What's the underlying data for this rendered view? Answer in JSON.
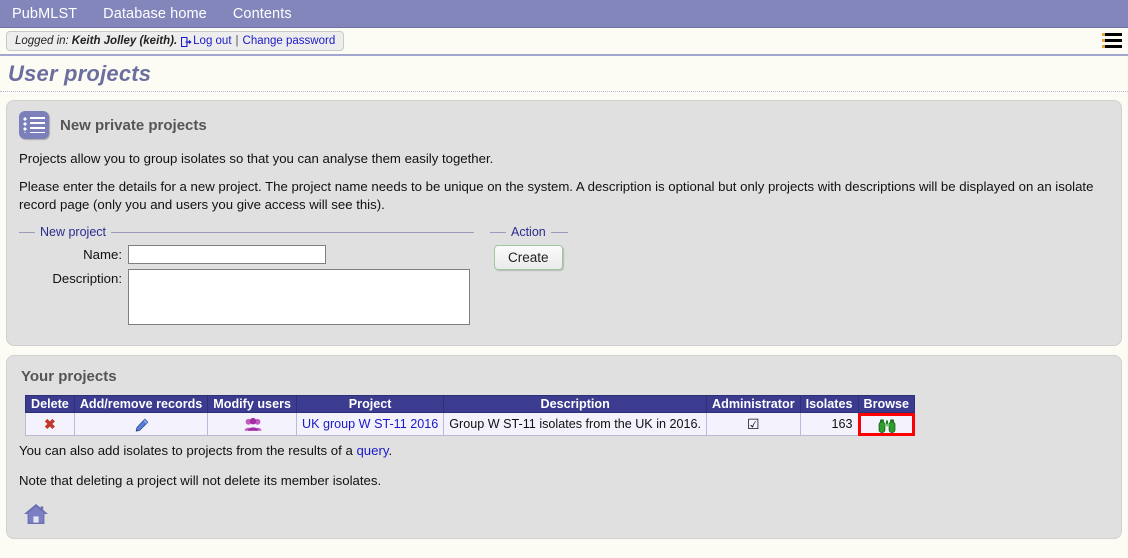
{
  "topnav": {
    "items": [
      {
        "label": "PubMLST",
        "name": "nav-pubmlst"
      },
      {
        "label": "Database home",
        "name": "nav-database-home"
      },
      {
        "label": "Contents",
        "name": "nav-contents"
      }
    ]
  },
  "loginbar": {
    "prefix": "Logged in:",
    "user": "Keith Jolley (keith).",
    "logout_label": "Log out",
    "separator": "|",
    "change_password_label": "Change password",
    "menu_icon": "hamburger-icon"
  },
  "page": {
    "title": "User projects"
  },
  "new_projects_panel": {
    "icon": "list-icon",
    "heading": "New private projects",
    "intro": "Projects allow you to group isolates so that you can analyse them easily together.",
    "description": "Please enter the details for a new project. The project name needs to be unique on the system. A description is optional but only projects with descriptions will be displayed on an isolate record page (only you and users you give access will see this).",
    "fieldset_new_project": {
      "legend": "New project",
      "name_label": "Name:",
      "name_value": "",
      "description_label": "Description:",
      "description_value": ""
    },
    "fieldset_action": {
      "legend": "Action",
      "create_label": "Create"
    }
  },
  "your_projects_panel": {
    "heading": "Your projects",
    "table": {
      "columns": [
        "Delete",
        "Add/remove records",
        "Modify users",
        "Project",
        "Description",
        "Administrator",
        "Isolates",
        "Browse"
      ],
      "rows": [
        {
          "delete_icon": "delete-cross-icon",
          "add_remove_icon": "pencil-icon",
          "modify_users_icon": "users-icon",
          "project": "UK group W ST-11 2016",
          "description": "Group W ST-11 isolates from the UK in 2016.",
          "administrator": "☑",
          "isolates": "163",
          "browse_icon": "binoculars-icon",
          "browse_highlight_color": "#ff0000"
        }
      ]
    },
    "note_query_prefix": "You can also add isolates to projects from the results of a ",
    "note_query_link": "query",
    "note_query_suffix": ".",
    "note_delete": "Note that deleting a project will not delete its member isolates.",
    "home_icon": "home-icon"
  },
  "colors": {
    "topnav_bg": "#8286bb",
    "page_title": "#6a6f9e",
    "table_header_bg": "#3b3b8f",
    "link": "#1a1acc",
    "highlight": "#ff0000",
    "panel_bg": "#e0e0e0"
  }
}
